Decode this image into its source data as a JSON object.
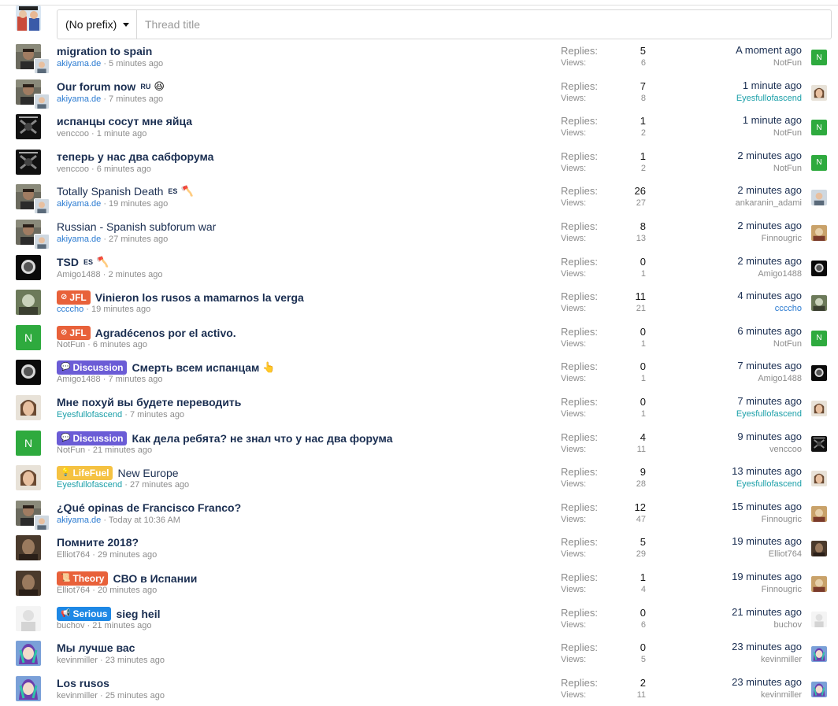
{
  "new_thread": {
    "prefix_value": "(No prefix)",
    "title_placeholder": "Thread title"
  },
  "colors": {
    "title": "#1a2e51",
    "muted": "#8c8c8c",
    "avatar_green": "#2eaa3e",
    "prefix_jfl": "#e8613a",
    "prefix_discussion": "#6b5cd6",
    "prefix_lifefuel": "#f5c242",
    "prefix_theory": "#e8613a",
    "prefix_serious": "#1e88e5"
  },
  "labels": {
    "replies": "Replies:",
    "views": "Views:"
  },
  "threads": [
    {
      "title": "migration to spain",
      "title_bold": true,
      "lang": "",
      "emoji": "",
      "prefix": "",
      "prefix_icon": "",
      "author": "akiyama.de",
      "author_style": "link",
      "time": "5 minutes ago",
      "replies": "5",
      "views": "6",
      "last_time": "A moment ago",
      "last_user": "NotFun",
      "last_user_style": "",
      "avatar": "photo-dark",
      "last_avatar": "letter-n"
    },
    {
      "title": "Our forum now",
      "title_bold": true,
      "lang": "RU",
      "emoji": "😆",
      "prefix": "",
      "prefix_icon": "",
      "author": "akiyama.de",
      "author_style": "link",
      "time": "7 minutes ago",
      "replies": "7",
      "views": "8",
      "last_time": "1 minute ago",
      "last_user": "Eyesfullofascend",
      "last_user_style": "teal",
      "avatar": "photo-dark",
      "last_avatar": "photo-face"
    },
    {
      "title": "испанцы сосут мне яйца",
      "title_bold": true,
      "lang": "",
      "emoji": "",
      "prefix": "",
      "prefix_icon": "",
      "author": "venccoo",
      "author_style": "",
      "time": "1 minute ago",
      "replies": "1",
      "views": "2",
      "last_time": "1 minute ago",
      "last_user": "NotFun",
      "last_user_style": "",
      "avatar": "photo-black",
      "last_avatar": "letter-n"
    },
    {
      "title": "теперь у нас два сабфорума",
      "title_bold": true,
      "lang": "",
      "emoji": "",
      "prefix": "",
      "prefix_icon": "",
      "author": "venccoo",
      "author_style": "",
      "time": "6 minutes ago",
      "replies": "1",
      "views": "2",
      "last_time": "2 minutes ago",
      "last_user": "NotFun",
      "last_user_style": "",
      "avatar": "photo-black",
      "last_avatar": "letter-n"
    },
    {
      "title": "Totally Spanish Death",
      "title_bold": false,
      "lang": "ES",
      "emoji": "🪓",
      "prefix": "",
      "prefix_icon": "",
      "author": "akiyama.de",
      "author_style": "link",
      "time": "19 minutes ago",
      "replies": "26",
      "views": "27",
      "last_time": "2 minutes ago",
      "last_user": "ankaranin_adami",
      "last_user_style": "",
      "avatar": "photo-dark",
      "last_avatar": "photo-kid"
    },
    {
      "title": "Russian - Spanish subforum war",
      "title_bold": false,
      "lang": "",
      "emoji": "",
      "prefix": "",
      "prefix_icon": "",
      "author": "akiyama.de",
      "author_style": "link",
      "time": "27 minutes ago",
      "replies": "8",
      "views": "13",
      "last_time": "2 minutes ago",
      "last_user": "Finnougric",
      "last_user_style": "",
      "avatar": "photo-dark",
      "last_avatar": "photo-art"
    },
    {
      "title": "TSD",
      "title_bold": true,
      "lang": "ES",
      "emoji": "🪓",
      "prefix": "",
      "prefix_icon": "",
      "author": "Amigo1488",
      "author_style": "",
      "time": "2 minutes ago",
      "replies": "0",
      "views": "1",
      "last_time": "2 minutes ago",
      "last_user": "Amigo1488",
      "last_user_style": "",
      "avatar": "photo-blackface",
      "last_avatar": "photo-blackface"
    },
    {
      "title": "Vinieron los rusos a mamarnos la verga",
      "title_bold": true,
      "lang": "",
      "emoji": "",
      "prefix": "JFL",
      "prefix_icon": "⊘",
      "author": "ccccho",
      "author_style": "link",
      "time": "19 minutes ago",
      "replies": "11",
      "views": "21",
      "last_time": "4 minutes ago",
      "last_user": "ccccho",
      "last_user_style": "link",
      "avatar": "photo-green",
      "last_avatar": "photo-green"
    },
    {
      "title": "Agradécenos por el activo.",
      "title_bold": true,
      "lang": "",
      "emoji": "",
      "prefix": "JFL",
      "prefix_icon": "⊘",
      "author": "NotFun",
      "author_style": "",
      "time": "6 minutes ago",
      "replies": "0",
      "views": "1",
      "last_time": "6 minutes ago",
      "last_user": "NotFun",
      "last_user_style": "",
      "avatar": "letter-n",
      "last_avatar": "letter-n"
    },
    {
      "title": "Смерть всем испанцам",
      "title_bold": true,
      "lang": "",
      "emoji": "👆",
      "prefix": "Discussion",
      "prefix_icon": "💬",
      "author": "Amigo1488",
      "author_style": "",
      "time": "7 minutes ago",
      "replies": "0",
      "views": "1",
      "last_time": "7 minutes ago",
      "last_user": "Amigo1488",
      "last_user_style": "",
      "avatar": "photo-blackface",
      "last_avatar": "photo-blackface"
    },
    {
      "title": "Мне похуй вы будете переводить",
      "title_bold": true,
      "lang": "",
      "emoji": "",
      "prefix": "",
      "prefix_icon": "",
      "author": "Eyesfullofascend",
      "author_style": "teal",
      "time": "7 minutes ago",
      "replies": "0",
      "views": "1",
      "last_time": "7 minutes ago",
      "last_user": "Eyesfullofascend",
      "last_user_style": "teal",
      "avatar": "photo-face",
      "last_avatar": "photo-face"
    },
    {
      "title": "Как дела ребята? не знал что у нас два форума",
      "title_bold": true,
      "lang": "",
      "emoji": "",
      "prefix": "Discussion",
      "prefix_icon": "💬",
      "author": "NotFun",
      "author_style": "",
      "time": "21 minutes ago",
      "replies": "4",
      "views": "11",
      "last_time": "9 minutes ago",
      "last_user": "venccoo",
      "last_user_style": "",
      "avatar": "letter-n",
      "last_avatar": "photo-black"
    },
    {
      "title": "New Europe",
      "title_bold": false,
      "lang": "",
      "emoji": "",
      "prefix": "LifeFuel",
      "prefix_icon": "💡",
      "author": "Eyesfullofascend",
      "author_style": "teal",
      "time": "27 minutes ago",
      "replies": "9",
      "views": "28",
      "last_time": "13 minutes ago",
      "last_user": "Eyesfullofascend",
      "last_user_style": "teal",
      "avatar": "photo-face",
      "last_avatar": "photo-face"
    },
    {
      "title": "¿Qué opinas de Francisco Franco?",
      "title_bold": true,
      "lang": "",
      "emoji": "",
      "prefix": "",
      "prefix_icon": "",
      "author": "akiyama.de",
      "author_style": "link",
      "time": "Today at 10:36 AM",
      "replies": "12",
      "views": "47",
      "last_time": "15 minutes ago",
      "last_user": "Finnougric",
      "last_user_style": "",
      "avatar": "photo-dark",
      "last_avatar": "photo-art"
    },
    {
      "title": "Помните 2018?",
      "title_bold": true,
      "lang": "",
      "emoji": "",
      "prefix": "",
      "prefix_icon": "",
      "author": "Elliot764",
      "author_style": "",
      "time": "29 minutes ago",
      "replies": "5",
      "views": "29",
      "last_time": "19 minutes ago",
      "last_user": "Elliot764",
      "last_user_style": "",
      "avatar": "photo-brown",
      "last_avatar": "photo-brown"
    },
    {
      "title": "СВО в Испании",
      "title_bold": true,
      "lang": "",
      "emoji": "",
      "prefix": "Theory",
      "prefix_icon": "📜",
      "author": "Elliot764",
      "author_style": "",
      "time": "20 minutes ago",
      "replies": "1",
      "views": "4",
      "last_time": "19 minutes ago",
      "last_user": "Finnougric",
      "last_user_style": "",
      "avatar": "photo-brown",
      "last_avatar": "photo-art"
    },
    {
      "title": "sieg heil",
      "title_bold": true,
      "lang": "",
      "emoji": "",
      "prefix": "Serious",
      "prefix_icon": "📢",
      "author": "buchov",
      "author_style": "",
      "time": "21 minutes ago",
      "replies": "0",
      "views": "6",
      "last_time": "21 minutes ago",
      "last_user": "buchov",
      "last_user_style": "",
      "avatar": "photo-white",
      "last_avatar": "photo-white"
    },
    {
      "title": "Мы лучше вас",
      "title_bold": true,
      "lang": "",
      "emoji": "",
      "prefix": "",
      "prefix_icon": "",
      "author": "kevinmiller",
      "author_style": "",
      "time": "23 minutes ago",
      "replies": "0",
      "views": "5",
      "last_time": "23 minutes ago",
      "last_user": "kevinmiller",
      "last_user_style": "",
      "avatar": "photo-anime",
      "last_avatar": "photo-anime"
    },
    {
      "title": "Los rusos",
      "title_bold": true,
      "lang": "",
      "emoji": "",
      "prefix": "",
      "prefix_icon": "",
      "author": "kevinmiller",
      "author_style": "",
      "time": "25 minutes ago",
      "replies": "2",
      "views": "11",
      "last_time": "23 minutes ago",
      "last_user": "kevinmiller",
      "last_user_style": "",
      "avatar": "photo-anime",
      "last_avatar": "photo-anime"
    }
  ],
  "avatar_letter": "N"
}
